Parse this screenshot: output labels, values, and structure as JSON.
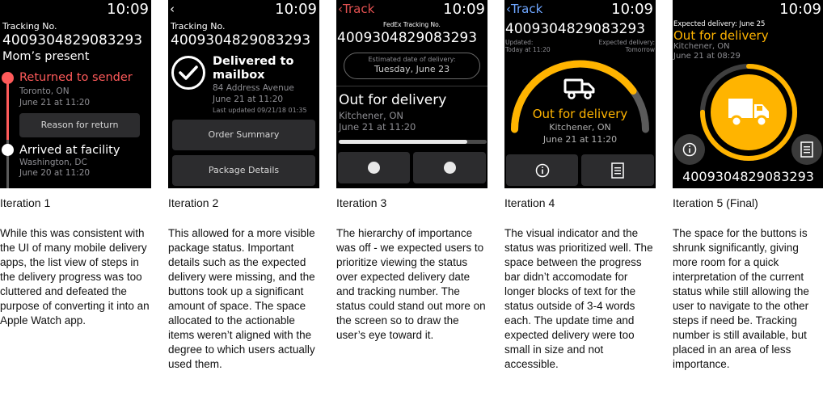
{
  "time": "10:09",
  "iterations": [
    {
      "caption": "Iteration 1",
      "description": "While this was consistent with the UI of many mobile delivery apps, the list view of steps in the delivery progress was too cluttered and defeated the purpose of converting it into an Apple Watch app.",
      "screen": {
        "tracking_label": "Tracking No.",
        "tracking_number": "4009304829083293",
        "package_name": "Mom’s present",
        "steps": [
          {
            "status": "Returned to sender",
            "location": "Toronto, ON",
            "date": "June 21 at 11:20",
            "color": "#ff5a5a"
          },
          {
            "status": "Arrived at facility",
            "location": "Washington, DC",
            "date": "June 20 at 11:20",
            "color": "#ffffff"
          }
        ],
        "reason_button": "Reason for return"
      }
    },
    {
      "caption": "Iteration 2",
      "description": "This allowed for a more visible package status. Important details such as the expected delivery were missing, and the buttons took up a significant amount of space. The space allocated to the actionable items weren’t aligned with the degree to which users actually used them.",
      "screen": {
        "tracking_label": "Tracking No.",
        "tracking_number": "4009304829083293",
        "status_line1": "Delivered to",
        "status_line2": "mailbox",
        "address": "84 Address Avenue",
        "date": "June 21 at 11:20",
        "last_updated": "Last updated 09/21/18 01:35",
        "buttons": [
          "Order Summary",
          "Package Details"
        ]
      }
    },
    {
      "caption": "Iteration 3",
      "description": "The hierarchy of importance was off - we expected users to prioritize viewing the status over expected delivery date and tracking number. The status could stand out more on the screen so to draw the user’s eye toward it.",
      "screen": {
        "back_label": "Track",
        "carrier_label": "FedEx Tracking No.",
        "tracking_number": "4009304829083293",
        "estimate_label": "Estimated date of delivery:",
        "estimate_value": "Tuesday, June 23",
        "status": "Out for delivery",
        "location": "Kitchener, ON",
        "date": "June 21 at 11:20",
        "progress": 0.87
      }
    },
    {
      "caption": "Iteration 4",
      "description": "The visual indicator and the status was prioritized well. The space between the progress bar didn’t accomodate for longer blocks of text for the status outside of 3-4 words each. The update time and expected delivery were too small in size and not accessible.",
      "screen": {
        "back_label": "Track",
        "tracking_number": "4009304829083293",
        "updated_label": "Updated:",
        "updated_value": "Today at 11:20",
        "expected_label": "Expected delivery:",
        "expected_value": "Tomorrow",
        "status": "Out for delivery",
        "location": "Kitchener, ON",
        "date": "June 21 at 11:20",
        "progress": 0.8,
        "accent": "#ffb400"
      }
    },
    {
      "caption": "Iteration 5 (Final)",
      "description": "The space for the buttons is shrunk significantly, giving more room for a quick interpretation of the current status while still allowing the user to navigate to the other steps if need be. Tracking number is still available, but placed in an area of less importance.",
      "screen": {
        "expected_label": "Expected delivery: June 25",
        "status": "Out for delivery",
        "location": "Kitchener, ON",
        "date": "June 21 at 08:29",
        "tracking_number": "4009304829083293",
        "progress": 0.75,
        "accent": "#ffb400"
      }
    }
  ]
}
